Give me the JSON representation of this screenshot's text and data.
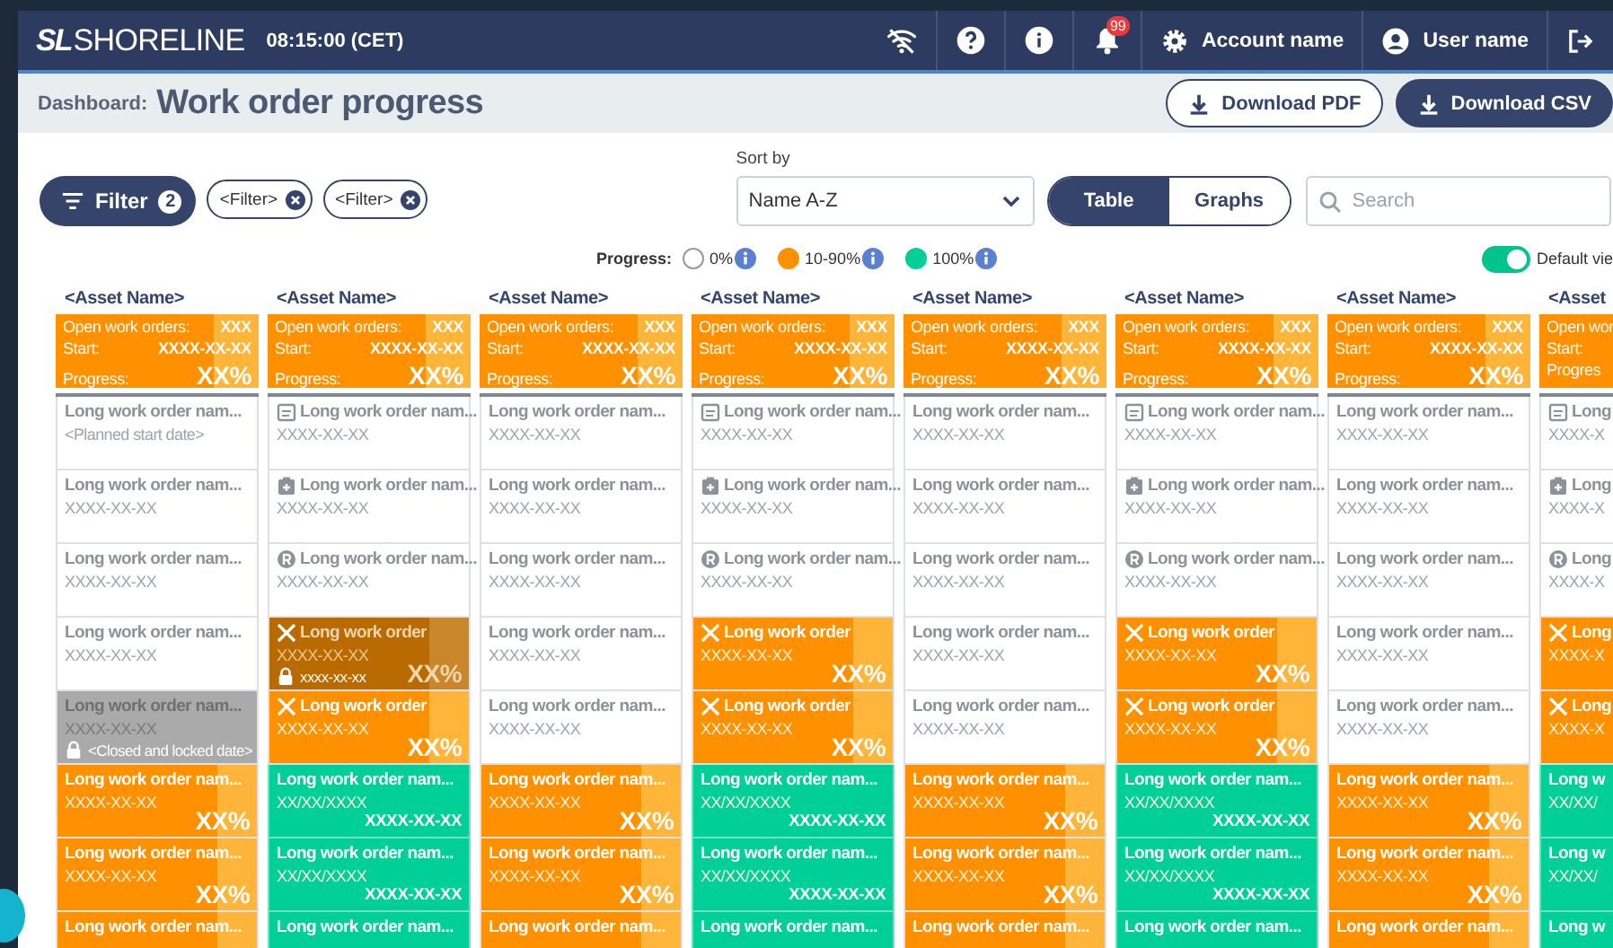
{
  "topbar": {
    "logo_mark": "SL",
    "logo_text": "SHORELINE",
    "time": "08:15:00 (CET)",
    "notification_count": "99",
    "account": "Account name",
    "user": "User name"
  },
  "subheader": {
    "breadcrumb": "Dashboard:",
    "title": "Work order progress",
    "buttons": [
      {
        "label": "Download PDF",
        "kind": "outline"
      },
      {
        "label": "Download CSV",
        "kind": "filled"
      }
    ]
  },
  "toolbar": {
    "filter": {
      "label": "Filter",
      "count": "2"
    },
    "chips": [
      "<Filter>",
      "<Filter>"
    ],
    "sort": {
      "label": "Sort by",
      "value": "Name A-Z"
    },
    "views": [
      {
        "label": "Table",
        "selected": true
      },
      {
        "label": "Graphs",
        "selected": false
      }
    ],
    "search": {
      "placeholder": "Search"
    }
  },
  "legend": {
    "label": "Progress:",
    "items": [
      {
        "label": "0%",
        "color": "#ffffff"
      },
      {
        "label": "10-90%",
        "color": "#ff9000"
      },
      {
        "label": "100%",
        "color": "#00cf98"
      }
    ],
    "default_view": {
      "label": "Default vie",
      "on": true
    }
  },
  "columns": [
    {
      "asset": "<Asset Name>",
      "open_label": "Open work orders:",
      "open": "XXX",
      "start_label": "Start:",
      "start": "XXXX-XX-XX",
      "progress_label": "Progress:",
      "progress": "XX%",
      "cells": [
        {
          "kind": "planned",
          "title": "Long work order nam...",
          "date": "<Planned start date>"
        },
        {
          "kind": "planned",
          "title": "Long work order nam...",
          "date": "XXXX-XX-XX"
        },
        {
          "kind": "planned",
          "title": "Long work order nam...",
          "date": "XXXX-XX-XX"
        },
        {
          "kind": "planned",
          "title": "Long work order nam...",
          "date": "XXXX-XX-XX"
        },
        {
          "kind": "closed",
          "title": "Long work order nam...",
          "date": "XXXX-XX-XX",
          "note": "<Closed and locked date>"
        },
        {
          "kind": "in_progress",
          "title": "Long work order nam...",
          "date": "XXXX-XX-XX",
          "progress": "XX%"
        },
        {
          "kind": "in_progress",
          "title": "Long work order nam...",
          "date": "XXXX-XX-XX",
          "progress": "XX%"
        },
        {
          "kind": "in_progress",
          "title": "Long work order nam..."
        }
      ]
    },
    {
      "asset": "<Asset Name>",
      "open_label": "Open work orders:",
      "open": "XXX",
      "start_label": "Start:",
      "start": "XXXX-XX-XX",
      "progress_label": "Progress:",
      "progress": "XX%",
      "cells": [
        {
          "kind": "planned_calendar",
          "title": "Long work order nam...",
          "date": "XXXX-XX-XX"
        },
        {
          "kind": "planned_clipboard",
          "title": "Long work order nam...",
          "date": "XXXX-XX-XX"
        },
        {
          "kind": "planned_r",
          "title": "Long work order nam...",
          "date": "XXXX-XX-XX"
        },
        {
          "kind": "cancelled_locked",
          "title": "Long work order",
          "date": "XXXX-XX-XX",
          "note": "xxxx-xx-xx",
          "progress": "XX%"
        },
        {
          "kind": "cancelled",
          "title": "Long work order",
          "date": "XXXX-XX-XX",
          "progress": "XX%"
        },
        {
          "kind": "done",
          "title": "Long work order nam...",
          "date": "XX/XX/XXXX",
          "end": "XXXX-XX-XX"
        },
        {
          "kind": "done",
          "title": "Long work order nam...",
          "date": "XX/XX/XXXX",
          "end": "XXXX-XX-XX"
        },
        {
          "kind": "done",
          "title": "Long work order nam..."
        }
      ]
    },
    {
      "asset": "<Asset Name>",
      "open_label": "Open work orders:",
      "open": "XXX",
      "start_label": "Start:",
      "start": "XXXX-XX-XX",
      "progress_label": "Progress:",
      "progress": "XX%",
      "cells": [
        {
          "kind": "planned",
          "title": "Long work order nam...",
          "date": "XXXX-XX-XX"
        },
        {
          "kind": "planned",
          "title": "Long work order nam...",
          "date": "XXXX-XX-XX"
        },
        {
          "kind": "planned",
          "title": "Long work order nam...",
          "date": "XXXX-XX-XX"
        },
        {
          "kind": "planned",
          "title": "Long work order nam...",
          "date": "XXXX-XX-XX"
        },
        {
          "kind": "planned",
          "title": "Long work order nam...",
          "date": "XXXX-XX-XX"
        },
        {
          "kind": "in_progress",
          "title": "Long work order nam...",
          "date": "XXXX-XX-XX",
          "progress": "XX%"
        },
        {
          "kind": "in_progress",
          "title": "Long work order nam...",
          "date": "XXXX-XX-XX",
          "progress": "XX%"
        },
        {
          "kind": "in_progress",
          "title": "Long work order nam..."
        }
      ]
    },
    {
      "asset": "<Asset Name>",
      "open_label": "Open work orders:",
      "open": "XXX",
      "start_label": "Start:",
      "start": "XXXX-XX-XX",
      "progress_label": "Progress:",
      "progress": "XX%",
      "cells": [
        {
          "kind": "planned_calendar",
          "title": "Long work order nam...",
          "date": "XXXX-XX-XX"
        },
        {
          "kind": "planned_clipboard",
          "title": "Long work order nam...",
          "date": "XXXX-XX-XX"
        },
        {
          "kind": "planned_r",
          "title": "Long work order nam...",
          "date": "XXXX-XX-XX"
        },
        {
          "kind": "cancelled",
          "title": "Long work order",
          "date": "XXXX-XX-XX",
          "progress": "XX%"
        },
        {
          "kind": "cancelled",
          "title": "Long work order",
          "date": "XXXX-XX-XX",
          "progress": "XX%"
        },
        {
          "kind": "done",
          "title": "Long work order nam...",
          "date": "XX/XX/XXXX",
          "end": "XXXX-XX-XX"
        },
        {
          "kind": "done",
          "title": "Long work order nam...",
          "date": "XX/XX/XXXX",
          "end": "XXXX-XX-XX"
        },
        {
          "kind": "done",
          "title": "Long work order nam..."
        }
      ]
    },
    {
      "asset": "<Asset Name>",
      "open_label": "Open work orders:",
      "open": "XXX",
      "start_label": "Start:",
      "start": "XXXX-XX-XX",
      "progress_label": "Progress:",
      "progress": "XX%",
      "cells": [
        {
          "kind": "planned",
          "title": "Long work order nam...",
          "date": "XXXX-XX-XX"
        },
        {
          "kind": "planned",
          "title": "Long work order nam...",
          "date": "XXXX-XX-XX"
        },
        {
          "kind": "planned",
          "title": "Long work order nam...",
          "date": "XXXX-XX-XX"
        },
        {
          "kind": "planned",
          "title": "Long work order nam...",
          "date": "XXXX-XX-XX"
        },
        {
          "kind": "planned",
          "title": "Long work order nam...",
          "date": "XXXX-XX-XX"
        },
        {
          "kind": "in_progress",
          "title": "Long work order nam...",
          "date": "XXXX-XX-XX",
          "progress": "XX%"
        },
        {
          "kind": "in_progress",
          "title": "Long work order nam...",
          "date": "XXXX-XX-XX",
          "progress": "XX%"
        },
        {
          "kind": "in_progress",
          "title": "Long work order nam..."
        }
      ]
    },
    {
      "asset": "<Asset Name>",
      "open_label": "Open work orders:",
      "open": "XXX",
      "start_label": "Start:",
      "start": "XXXX-XX-XX",
      "progress_label": "Progress:",
      "progress": "XX%",
      "cells": [
        {
          "kind": "planned_calendar",
          "title": "Long work order nam...",
          "date": "XXXX-XX-XX"
        },
        {
          "kind": "planned_clipboard",
          "title": "Long work order nam...",
          "date": "XXXX-XX-XX"
        },
        {
          "kind": "planned_r",
          "title": "Long work order nam...",
          "date": "XXXX-XX-XX"
        },
        {
          "kind": "cancelled",
          "title": "Long work order",
          "date": "XXXX-XX-XX",
          "progress": "XX%"
        },
        {
          "kind": "cancelled",
          "title": "Long work order",
          "date": "XXXX-XX-XX",
          "progress": "XX%"
        },
        {
          "kind": "done",
          "title": "Long work order nam...",
          "date": "XX/XX/XXXX",
          "end": "XXXX-XX-XX"
        },
        {
          "kind": "done",
          "title": "Long work order nam...",
          "date": "XX/XX/XXXX",
          "end": "XXXX-XX-XX"
        },
        {
          "kind": "done",
          "title": "Long work order nam..."
        }
      ]
    },
    {
      "asset": "<Asset Name>",
      "open_label": "Open work orders:",
      "open": "XXX",
      "start_label": "Start:",
      "start": "XXXX-XX-XX",
      "progress_label": "Progress:",
      "progress": "XX%",
      "cells": [
        {
          "kind": "planned",
          "title": "Long work order nam...",
          "date": "XXXX-XX-XX"
        },
        {
          "kind": "planned",
          "title": "Long work order nam...",
          "date": "XXXX-XX-XX"
        },
        {
          "kind": "planned",
          "title": "Long work order nam...",
          "date": "XXXX-XX-XX"
        },
        {
          "kind": "planned",
          "title": "Long work order nam...",
          "date": "XXXX-XX-XX"
        },
        {
          "kind": "planned",
          "title": "Long work order nam...",
          "date": "XXXX-XX-XX"
        },
        {
          "kind": "in_progress",
          "title": "Long work order nam...",
          "date": "XXXX-XX-XX",
          "progress": "XX%"
        },
        {
          "kind": "in_progress",
          "title": "Long work order nam...",
          "date": "XXXX-XX-XX",
          "progress": "XX%"
        },
        {
          "kind": "in_progress",
          "title": "Long work order nam..."
        }
      ]
    },
    {
      "asset": "<Asset",
      "open_label": "Open wor",
      "start_label": "Start:",
      "progress_label": "Progres",
      "cells": [
        {
          "kind": "planned_calendar",
          "title": "Long",
          "date": "XXXX-X"
        },
        {
          "kind": "planned_clipboard",
          "title": "Long",
          "date": "XXXX-X"
        },
        {
          "kind": "planned_r",
          "title": "Long",
          "date": "XXXX-X"
        },
        {
          "kind": "cancelled",
          "title": "Long",
          "date": "XXXX-X"
        },
        {
          "kind": "cancelled",
          "title": "Long",
          "date": "XXXX-X"
        },
        {
          "kind": "done",
          "title": "Long w",
          "date": "XX/XX/"
        },
        {
          "kind": "done",
          "title": "Long w",
          "date": "XX/XX/"
        },
        {
          "kind": "done",
          "title": "Long w"
        }
      ]
    }
  ]
}
